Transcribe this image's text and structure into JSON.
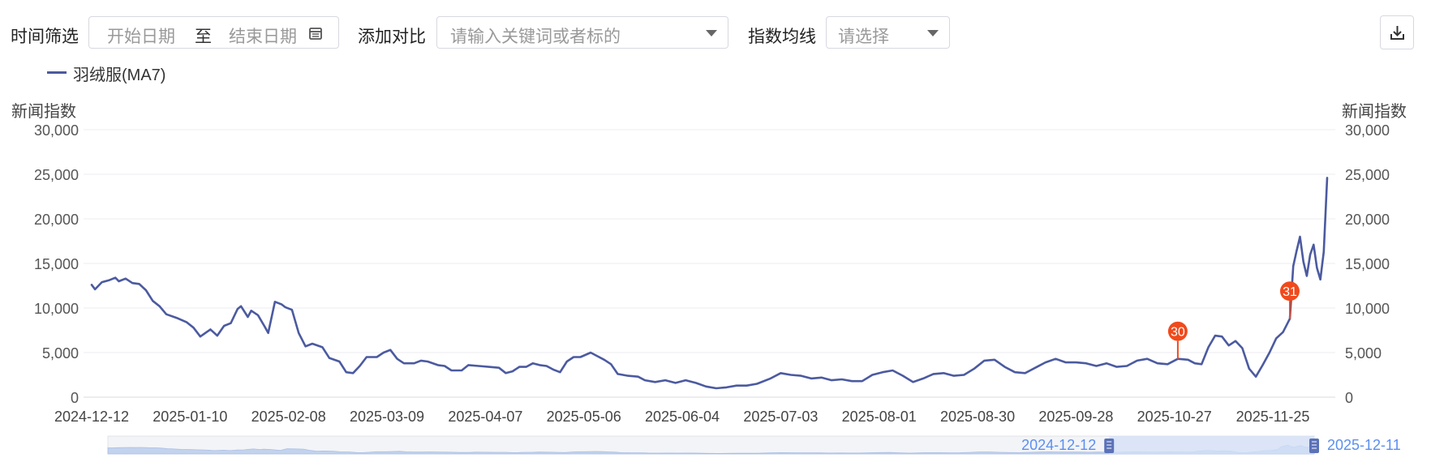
{
  "toolbar": {
    "time_filter_label": "时间筛选",
    "start_date_placeholder": "开始日期",
    "range_separator": "至",
    "end_date_placeholder": "结束日期",
    "compare_label": "添加对比",
    "compare_placeholder": "请输入关键词或者标的",
    "ma_label": "指数均线",
    "ma_placeholder": "请选择"
  },
  "legend": {
    "series_name": "羽绒服(MA7)"
  },
  "axis": {
    "left_title": "新闻指数",
    "right_title": "新闻指数"
  },
  "slider": {
    "start_label": "2024-12-12",
    "end_label": "2025-12-11",
    "selection_start": 0.83,
    "selection_end": 1.0
  },
  "colors": {
    "line": "#4b5aa0",
    "marker": "#f04a1c",
    "slider_fill": "#d3e0f7",
    "slider_text": "#5b8ff0"
  },
  "chart_data": {
    "type": "line",
    "xlabel": "",
    "ylabel": "新闻指数",
    "ylim": [
      0,
      30000
    ],
    "yticks": [
      0,
      5000,
      10000,
      15000,
      20000,
      25000,
      30000
    ],
    "ytick_labels": [
      "0",
      "5,000",
      "10,000",
      "15,000",
      "20,000",
      "25,000",
      "30,000"
    ],
    "xticks": [
      "2024-12-12",
      "2025-01-10",
      "2025-02-08",
      "2025-03-09",
      "2025-04-07",
      "2025-05-06",
      "2025-06-04",
      "2025-07-03",
      "2025-08-01",
      "2025-08-30",
      "2025-09-28",
      "2025-10-27",
      "2025-11-25"
    ],
    "x_start": "2024-12-12",
    "x_end": "2025-12-11",
    "grid": true,
    "legend": "top-left",
    "series": [
      {
        "name": "羽绒服(MA7)",
        "points": [
          [
            "2024-12-12",
            12600
          ],
          [
            "2024-12-13",
            12100
          ],
          [
            "2024-12-15",
            12900
          ],
          [
            "2024-12-17",
            13100
          ],
          [
            "2024-12-19",
            13400
          ],
          [
            "2024-12-20",
            13000
          ],
          [
            "2024-12-22",
            13300
          ],
          [
            "2024-12-24",
            12800
          ],
          [
            "2024-12-26",
            12700
          ],
          [
            "2024-12-28",
            12000
          ],
          [
            "2024-12-30",
            10800
          ],
          [
            "2025-01-01",
            10200
          ],
          [
            "2025-01-03",
            9300
          ],
          [
            "2025-01-06",
            8900
          ],
          [
            "2025-01-09",
            8400
          ],
          [
            "2025-01-11",
            7800
          ],
          [
            "2025-01-13",
            6800
          ],
          [
            "2025-01-16",
            7600
          ],
          [
            "2025-01-18",
            6900
          ],
          [
            "2025-01-20",
            8000
          ],
          [
            "2025-01-22",
            8300
          ],
          [
            "2025-01-24",
            9900
          ],
          [
            "2025-01-25",
            10200
          ],
          [
            "2025-01-27",
            9000
          ],
          [
            "2025-01-28",
            9700
          ],
          [
            "2025-01-30",
            9200
          ],
          [
            "2025-02-01",
            7900
          ],
          [
            "2025-02-02",
            7200
          ],
          [
            "2025-02-04",
            10700
          ],
          [
            "2025-02-06",
            10400
          ],
          [
            "2025-02-07",
            10100
          ],
          [
            "2025-02-09",
            9800
          ],
          [
            "2025-02-11",
            7200
          ],
          [
            "2025-02-13",
            5700
          ],
          [
            "2025-02-15",
            6000
          ],
          [
            "2025-02-18",
            5600
          ],
          [
            "2025-02-20",
            4400
          ],
          [
            "2025-02-23",
            4000
          ],
          [
            "2025-02-25",
            2800
          ],
          [
            "2025-02-27",
            2700
          ],
          [
            "2025-03-01",
            3500
          ],
          [
            "2025-03-03",
            4500
          ],
          [
            "2025-03-06",
            4500
          ],
          [
            "2025-03-08",
            5000
          ],
          [
            "2025-03-10",
            5300
          ],
          [
            "2025-03-12",
            4300
          ],
          [
            "2025-03-14",
            3800
          ],
          [
            "2025-03-17",
            3800
          ],
          [
            "2025-03-19",
            4100
          ],
          [
            "2025-03-21",
            4000
          ],
          [
            "2025-03-24",
            3600
          ],
          [
            "2025-03-26",
            3500
          ],
          [
            "2025-03-28",
            3000
          ],
          [
            "2025-03-31",
            3000
          ],
          [
            "2025-04-02",
            3600
          ],
          [
            "2025-04-05",
            3500
          ],
          [
            "2025-04-08",
            3400
          ],
          [
            "2025-04-11",
            3300
          ],
          [
            "2025-04-13",
            2700
          ],
          [
            "2025-04-15",
            2900
          ],
          [
            "2025-04-17",
            3400
          ],
          [
            "2025-04-19",
            3400
          ],
          [
            "2025-04-21",
            3800
          ],
          [
            "2025-04-23",
            3600
          ],
          [
            "2025-04-25",
            3500
          ],
          [
            "2025-04-27",
            3100
          ],
          [
            "2025-04-29",
            2800
          ],
          [
            "2025-05-01",
            4000
          ],
          [
            "2025-05-03",
            4500
          ],
          [
            "2025-05-05",
            4500
          ],
          [
            "2025-05-08",
            5000
          ],
          [
            "2025-05-10",
            4600
          ],
          [
            "2025-05-12",
            4200
          ],
          [
            "2025-05-14",
            3700
          ],
          [
            "2025-05-16",
            2600
          ],
          [
            "2025-05-19",
            2400
          ],
          [
            "2025-05-22",
            2300
          ],
          [
            "2025-05-24",
            1900
          ],
          [
            "2025-05-27",
            1700
          ],
          [
            "2025-05-30",
            1900
          ],
          [
            "2025-06-02",
            1600
          ],
          [
            "2025-06-05",
            1900
          ],
          [
            "2025-06-08",
            1600
          ],
          [
            "2025-06-11",
            1200
          ],
          [
            "2025-06-14",
            1000
          ],
          [
            "2025-06-17",
            1100
          ],
          [
            "2025-06-20",
            1300
          ],
          [
            "2025-06-23",
            1300
          ],
          [
            "2025-06-26",
            1500
          ],
          [
            "2025-06-30",
            2100
          ],
          [
            "2025-07-03",
            2700
          ],
          [
            "2025-07-06",
            2500
          ],
          [
            "2025-07-09",
            2400
          ],
          [
            "2025-07-12",
            2100
          ],
          [
            "2025-07-15",
            2200
          ],
          [
            "2025-07-18",
            1900
          ],
          [
            "2025-07-21",
            2000
          ],
          [
            "2025-07-24",
            1800
          ],
          [
            "2025-07-27",
            1800
          ],
          [
            "2025-07-30",
            2500
          ],
          [
            "2025-08-02",
            2800
          ],
          [
            "2025-08-05",
            3000
          ],
          [
            "2025-08-08",
            2400
          ],
          [
            "2025-08-11",
            1700
          ],
          [
            "2025-08-14",
            2100
          ],
          [
            "2025-08-17",
            2600
          ],
          [
            "2025-08-20",
            2700
          ],
          [
            "2025-08-23",
            2400
          ],
          [
            "2025-08-26",
            2500
          ],
          [
            "2025-08-29",
            3200
          ],
          [
            "2025-09-01",
            4100
          ],
          [
            "2025-09-04",
            4200
          ],
          [
            "2025-09-07",
            3400
          ],
          [
            "2025-09-10",
            2800
          ],
          [
            "2025-09-13",
            2700
          ],
          [
            "2025-09-16",
            3300
          ],
          [
            "2025-09-19",
            3900
          ],
          [
            "2025-09-22",
            4300
          ],
          [
            "2025-09-25",
            3900
          ],
          [
            "2025-09-28",
            3900
          ],
          [
            "2025-10-01",
            3800
          ],
          [
            "2025-10-04",
            3500
          ],
          [
            "2025-10-07",
            3800
          ],
          [
            "2025-10-10",
            3400
          ],
          [
            "2025-10-13",
            3500
          ],
          [
            "2025-10-16",
            4100
          ],
          [
            "2025-10-19",
            4300
          ],
          [
            "2025-10-22",
            3800
          ],
          [
            "2025-10-25",
            3700
          ],
          [
            "2025-10-28",
            4300
          ],
          [
            "2025-10-31",
            4200
          ],
          [
            "2025-11-02",
            3800
          ],
          [
            "2025-11-04",
            3700
          ],
          [
            "2025-11-06",
            5600
          ],
          [
            "2025-11-08",
            6900
          ],
          [
            "2025-11-10",
            6800
          ],
          [
            "2025-11-12",
            5800
          ],
          [
            "2025-11-14",
            6300
          ],
          [
            "2025-11-16",
            5500
          ],
          [
            "2025-11-18",
            3200
          ],
          [
            "2025-11-20",
            2300
          ],
          [
            "2025-11-22",
            3600
          ],
          [
            "2025-11-24",
            5000
          ],
          [
            "2025-11-26",
            6600
          ],
          [
            "2025-11-28",
            7300
          ],
          [
            "2025-11-30",
            8800
          ],
          [
            "2025-12-01",
            14700
          ],
          [
            "2025-12-02",
            16400
          ],
          [
            "2025-12-03",
            18000
          ],
          [
            "2025-12-04",
            15200
          ],
          [
            "2025-12-05",
            13600
          ],
          [
            "2025-12-06",
            16000
          ],
          [
            "2025-12-07",
            17100
          ],
          [
            "2025-12-08",
            14500
          ],
          [
            "2025-12-09",
            13200
          ],
          [
            "2025-12-10",
            16300
          ],
          [
            "2025-12-11",
            24600
          ]
        ]
      }
    ],
    "annotations": [
      {
        "label": "30",
        "x": "2025-10-28",
        "y": 4300
      },
      {
        "label": "31",
        "x": "2025-11-30",
        "y": 8800
      }
    ]
  }
}
